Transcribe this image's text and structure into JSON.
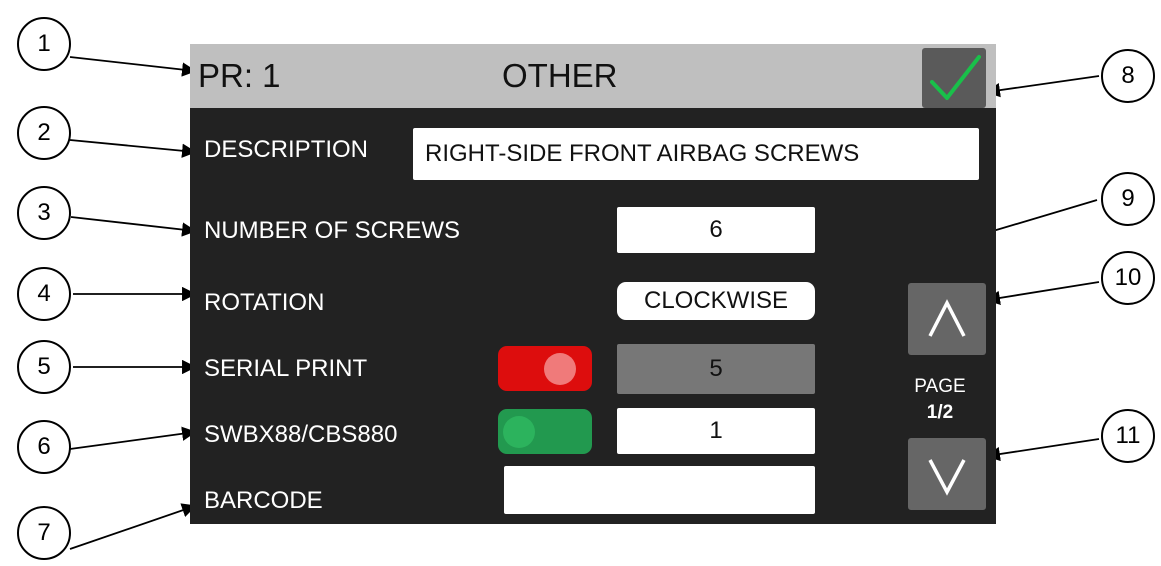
{
  "header": {
    "pr_label": "PR: 1",
    "title": "OTHER",
    "confirm_icon": "checkmark-icon"
  },
  "form": {
    "description_label": "DESCRIPTION",
    "description_value": "RIGHT-SIDE FRONT AIRBAG  SCREWS",
    "screws_label": "NUMBER OF SCREWS",
    "screws_value": "6",
    "rotation_label": "ROTATION",
    "rotation_value": "CLOCKWISE",
    "serial_label": "SERIAL PRINT",
    "serial_toggle_state": "on",
    "serial_value": "5",
    "sw_label": "SWBX88/CBS880",
    "sw_toggle_state": "off",
    "sw_value": "1",
    "barcode_label": "BARCODE",
    "barcode_value": ""
  },
  "pager": {
    "label": "PAGE",
    "value": "1/2",
    "up_icon": "chevron-up-icon",
    "down_icon": "chevron-down-icon"
  },
  "callouts": [
    "1",
    "2",
    "3",
    "4",
    "5",
    "6",
    "7",
    "8",
    "9",
    "10",
    "11"
  ],
  "colors": {
    "header_bg": "#bfbfbf",
    "screen_bg": "#222222",
    "confirm_check": "#19c04a",
    "serial_toggle_on": "#dd0d0d",
    "sw_toggle_off": "#22994f",
    "disabled_field": "#777777"
  }
}
